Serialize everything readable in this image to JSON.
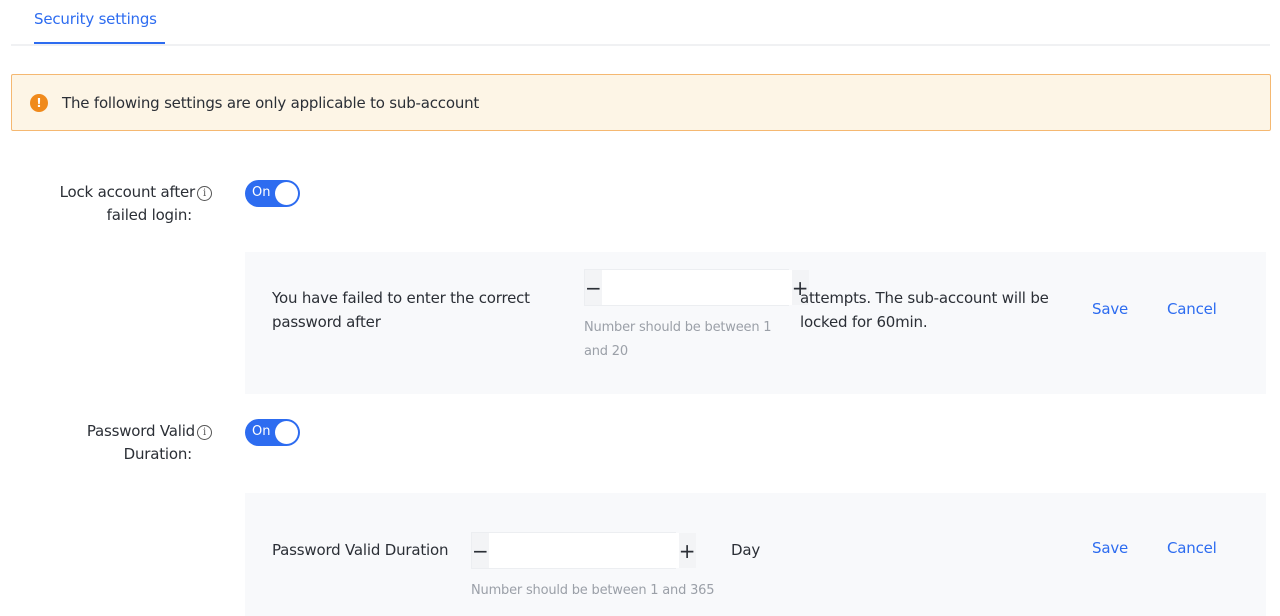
{
  "tabs": [
    {
      "label": "Security settings",
      "active": true
    }
  ],
  "alert": {
    "icon": "warning-icon",
    "text": "The following settings are only applicable to sub-account",
    "color": "#f08a1c"
  },
  "colors": {
    "accent": "#2d6cf0",
    "alert_bg": "#fdf5e6",
    "alert_border": "#f5b871"
  },
  "lock_account": {
    "label_line1": "Lock account after",
    "label_line2": "failed login:",
    "info_icon": "info-icon",
    "toggle": {
      "label": "On",
      "value": true
    },
    "text_before": "You have failed to enter the correct password after",
    "input_value": "",
    "input_placeholder": "",
    "decrement": "−",
    "increment": "+",
    "hint": "Number should be between 1 and 20",
    "text_after": "attempts. The sub-account will be locked for 60min.",
    "save_label": "Save",
    "cancel_label": "Cancel"
  },
  "password_duration": {
    "label_line1": "Password Valid",
    "label_line2": "Duration:",
    "info_icon": "info-icon",
    "toggle": {
      "label": "On",
      "value": true
    },
    "field_label": "Password Valid Duration",
    "input_value": "",
    "input_placeholder": "",
    "decrement": "−",
    "increment": "+",
    "unit": "Day",
    "hint": "Number should be between 1 and 365",
    "save_label": "Save",
    "cancel_label": "Cancel"
  }
}
